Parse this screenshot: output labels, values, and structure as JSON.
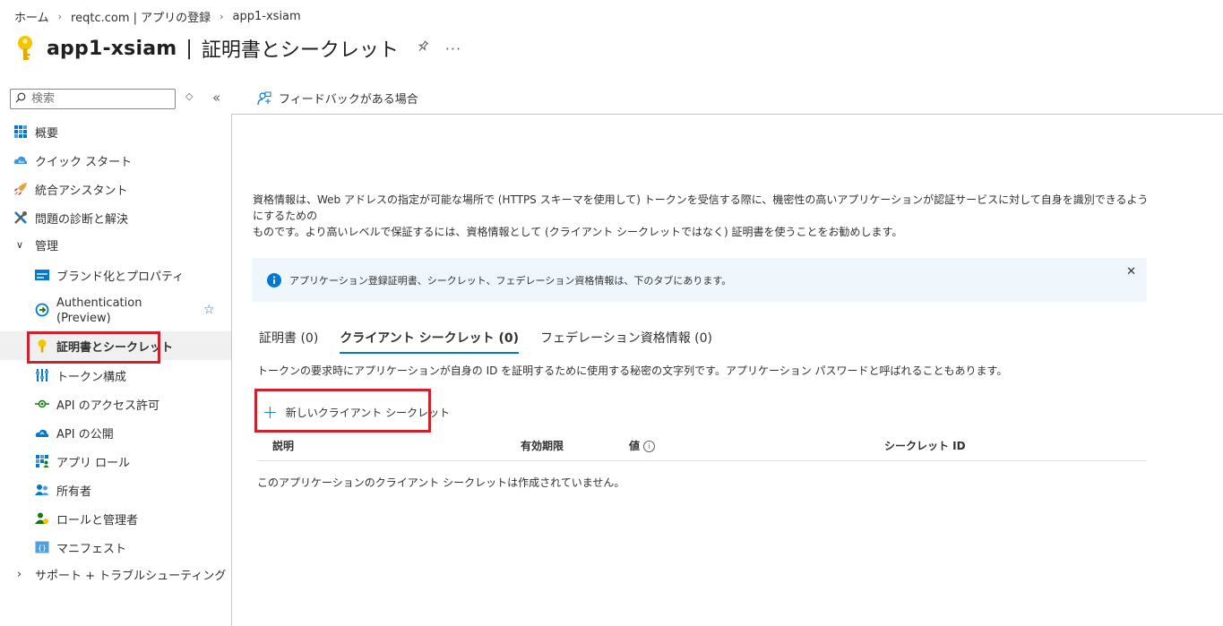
{
  "breadcrumb": {
    "home": "ホーム",
    "tenant": "reqtc.com | アプリの登録",
    "app": "app1-xsiam"
  },
  "page": {
    "app_name": "app1-xsiam",
    "separator": "|",
    "section": "証明書とシークレット"
  },
  "search": {
    "placeholder": "検索"
  },
  "sidebar": {
    "items": [
      {
        "label": "概要",
        "icon": "overview-grid-icon"
      },
      {
        "label": "クイック スタート",
        "icon": "quickstart-cloud-icon"
      },
      {
        "label": "統合アシスタント",
        "icon": "rocket-icon"
      },
      {
        "label": "問題の診断と解決",
        "icon": "wrench-icon"
      }
    ],
    "manage_group": "管理",
    "manage_items": [
      {
        "label": "ブランド化とプロパティ",
        "icon": "branding-icon"
      },
      {
        "label": "Authentication",
        "label2": "(Preview)",
        "icon": "authentication-icon"
      },
      {
        "label": "証明書とシークレット",
        "icon": "key-icon"
      },
      {
        "label": "トークン構成",
        "icon": "token-config-icon"
      },
      {
        "label": "API のアクセス許可",
        "icon": "api-permissions-icon"
      },
      {
        "label": "API の公開",
        "icon": "expose-api-icon"
      },
      {
        "label": "アプリ ロール",
        "icon": "app-roles-icon"
      },
      {
        "label": "所有者",
        "icon": "owners-icon"
      },
      {
        "label": "ロールと管理者",
        "icon": "roles-admins-icon"
      },
      {
        "label": "マニフェスト",
        "icon": "manifest-icon"
      }
    ],
    "support_group": "サポート + トラブルシューティング"
  },
  "toolbar": {
    "feedback_label": "フィードバックがある場合"
  },
  "content": {
    "description_line1": "資格情報は、Web アドレスの指定が可能な場所で (HTTPS スキーマを使用して) トークンを受信する際に、機密性の高いアプリケーションが認証サービスに対して自身を識別できるようにするための",
    "description_line2": "ものです。より高いレベルで保証するには、資格情報として (クライアント シークレットではなく) 証明書を使うことをお勧めします。",
    "info_message": "アプリケーション登録証明書、シークレット、フェデレーション資格情報は、下のタブにあります。",
    "tabs": [
      "証明書 (0)",
      "クライアント シークレット (0)",
      "フェデレーション資格情報 (0)"
    ],
    "secret_description": "トークンの要求時にアプリケーションが自身の ID を証明するために使用する秘密の文字列です。アプリケーション パスワードと呼ばれることもあります。",
    "new_secret_label": "新しいクライアント シークレット",
    "table_headers": [
      "説明",
      "有効期限",
      "値",
      "シークレット ID"
    ],
    "empty_message": "このアプリケーションのクライアント シークレットは作成されていません。"
  },
  "colors": {
    "accent": "#0078d4",
    "highlight": "#d0202a",
    "info_bg": "#eff6fc",
    "key": "#f8c400"
  }
}
